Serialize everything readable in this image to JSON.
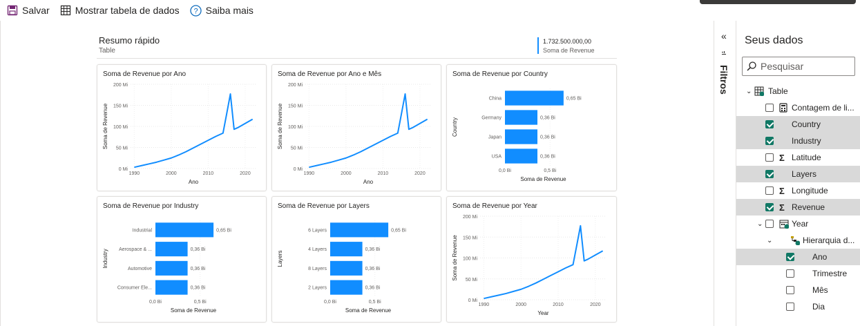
{
  "toolbar": {
    "save": "Salvar",
    "show_table": "Mostrar tabela de dados",
    "learn_more": "Saiba mais"
  },
  "summary": {
    "title": "Resumo rápido",
    "subtitle": "Table",
    "kpi_value": "1.732.500.000,00",
    "kpi_label": "Soma de Revenue"
  },
  "colors": {
    "accent": "#118dff",
    "check": "#117865"
  },
  "filters_label": "Filtros",
  "data_pane": {
    "title": "Seus dados",
    "search_placeholder": "Pesquisar",
    "items": [
      {
        "label": "Table",
        "checked": false,
        "icon": "table-icon"
      },
      {
        "label": "Contagem de li...",
        "checked": false,
        "icon": "calculator-icon"
      },
      {
        "label": "Country",
        "checked": true,
        "icon": ""
      },
      {
        "label": "Industry",
        "checked": true,
        "icon": ""
      },
      {
        "label": "Latitude",
        "checked": false,
        "icon": "sigma-icon"
      },
      {
        "label": "Layers",
        "checked": true,
        "icon": ""
      },
      {
        "label": "Longitude",
        "checked": false,
        "icon": "sigma-icon"
      },
      {
        "label": "Revenue",
        "checked": true,
        "icon": "sigma-icon"
      },
      {
        "label": "Year",
        "checked": false,
        "icon": "calendar-icon"
      },
      {
        "label": "Hierarquia d...",
        "checked": false,
        "icon": "hierarchy-icon"
      },
      {
        "label": "Ano",
        "checked": true,
        "icon": ""
      },
      {
        "label": "Trimestre",
        "checked": false,
        "icon": ""
      },
      {
        "label": "Mês",
        "checked": false,
        "icon": ""
      },
      {
        "label": "Dia",
        "checked": false,
        "icon": ""
      }
    ]
  },
  "chart_data": [
    {
      "type": "line",
      "title": "Soma de Revenue por Ano",
      "xlabel": "Ano",
      "ylabel": "Soma de Revenue",
      "yticks": [
        "0 Mi",
        "50 Mi",
        "100 Mi",
        "150 Mi",
        "200 Mi"
      ],
      "xticks": [
        "1990",
        "2000",
        "2010",
        "2020"
      ],
      "xlim": [
        1989,
        2023
      ],
      "ylim": [
        0,
        200
      ],
      "x": [
        1990,
        1992,
        1994,
        1996,
        1998,
        2000,
        2002,
        2004,
        2006,
        2008,
        2010,
        2012,
        2014,
        2015,
        2016,
        2017,
        2018,
        2020,
        2022
      ],
      "y": [
        3,
        7,
        11,
        15,
        20,
        25,
        32,
        40,
        49,
        58,
        67,
        76,
        84,
        130,
        177,
        93,
        97,
        107,
        117
      ]
    },
    {
      "type": "line",
      "title": "Soma de Revenue por Ano e Mês",
      "xlabel": "Ano",
      "ylabel": "Soma de Revenue",
      "yticks": [
        "0 Mi",
        "50 Mi",
        "100 Mi",
        "150 Mi",
        "200 Mi"
      ],
      "xticks": [
        "1990",
        "2000",
        "2010",
        "2020"
      ],
      "xlim": [
        1989,
        2023
      ],
      "ylim": [
        0,
        200
      ],
      "x": [
        1990,
        1992,
        1994,
        1996,
        1998,
        2000,
        2002,
        2004,
        2006,
        2008,
        2010,
        2012,
        2014,
        2015,
        2016,
        2017,
        2018,
        2020,
        2022
      ],
      "y": [
        3,
        7,
        11,
        15,
        20,
        25,
        32,
        40,
        49,
        58,
        67,
        76,
        84,
        130,
        177,
        93,
        97,
        107,
        117
      ]
    },
    {
      "type": "bar",
      "title": "Soma de Revenue por Country",
      "xlabel": "Soma de Revenue",
      "ylabel": "Country",
      "categories": [
        "China",
        "Germany",
        "Japan",
        "USA"
      ],
      "values": [
        0.65,
        0.36,
        0.36,
        0.36
      ],
      "value_labels": [
        "0,65 Bi",
        "0,36 Bi",
        "0,36 Bi",
        "0,36 Bi"
      ],
      "xticks": [
        "0,0 Bi",
        "0,5 Bi"
      ],
      "xlim": [
        0,
        0.85
      ]
    },
    {
      "type": "bar",
      "title": "Soma de Revenue por Industry",
      "xlabel": "Soma de Revenue",
      "ylabel": "Industry",
      "categories": [
        "Industrial",
        "Aerospace & ...",
        "Automotive",
        "Consumer Ele..."
      ],
      "values": [
        0.65,
        0.36,
        0.36,
        0.36
      ],
      "value_labels": [
        "0,65 Bi",
        "0,36 Bi",
        "0,36 Bi",
        "0,36 Bi"
      ],
      "xticks": [
        "0,0 Bi",
        "0,5 Bi"
      ],
      "xlim": [
        0,
        0.85
      ]
    },
    {
      "type": "bar",
      "title": "Soma de Revenue por Layers",
      "xlabel": "Soma de Revenue",
      "ylabel": "Layers",
      "categories": [
        "6 Layers",
        "4 Layers",
        "8 Layers",
        "2 Layers"
      ],
      "values": [
        0.65,
        0.36,
        0.36,
        0.36
      ],
      "value_labels": [
        "0,65 Bi",
        "0,36 Bi",
        "0,36 Bi",
        "0,36 Bi"
      ],
      "xticks": [
        "0,0 Bi",
        "0,5 Bi"
      ],
      "xlim": [
        0,
        0.85
      ]
    },
    {
      "type": "line",
      "title": "Soma de Revenue por Year",
      "xlabel": "Year",
      "ylabel": "Soma de Revenue",
      "yticks": [
        "0 Mi",
        "50 Mi",
        "100 Mi",
        "150 Mi",
        "200 Mi"
      ],
      "xticks": [
        "1990",
        "2000",
        "2010",
        "2020"
      ],
      "xlim": [
        1989,
        2023
      ],
      "ylim": [
        0,
        200
      ],
      "x": [
        1990,
        1992,
        1994,
        1996,
        1998,
        2000,
        2002,
        2004,
        2006,
        2008,
        2010,
        2012,
        2014,
        2015,
        2016,
        2017,
        2018,
        2020,
        2022
      ],
      "y": [
        3,
        7,
        11,
        15,
        20,
        25,
        32,
        40,
        49,
        58,
        67,
        76,
        84,
        130,
        177,
        93,
        97,
        107,
        117
      ]
    }
  ]
}
